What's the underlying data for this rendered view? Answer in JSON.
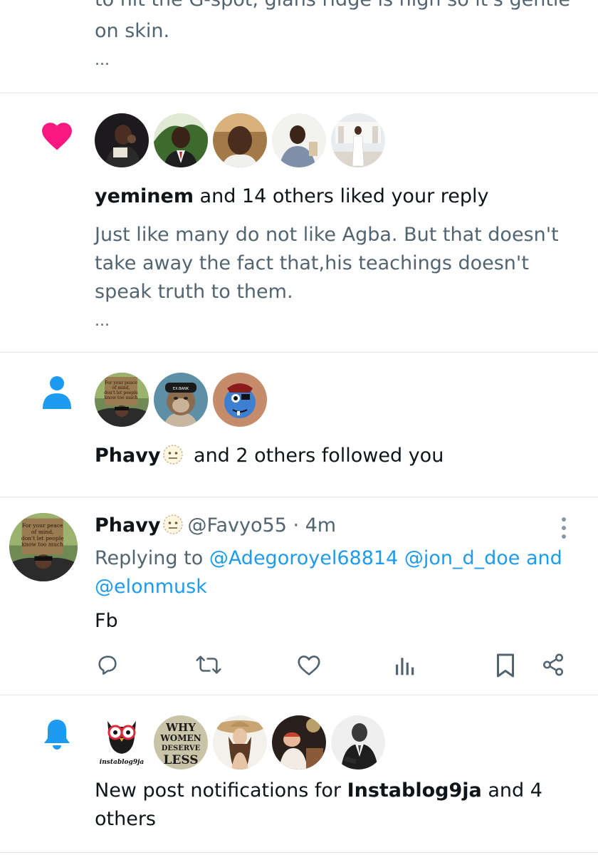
{
  "top_snippet": {
    "line1": "to hit the G-spot, glans ridge is high so it's gentle",
    "line2": "on skin.",
    "ellipsis": "..."
  },
  "like_notification": {
    "icon": "heart-icon",
    "icon_color": "#f91880",
    "user": "yeminem",
    "text_suffix": " and 14 others liked your reply",
    "reply_lines": [
      "Just like many do not like Agba. But that doesn't",
      "take away the fact that,his teachings doesn't",
      "speak truth to them."
    ],
    "ellipsis": "..."
  },
  "follow_notification": {
    "icon": "person-icon",
    "icon_color": "#1d9bf0",
    "user": "Phavy",
    "text_suffix": " and 2 others followed you"
  },
  "reply_tweet": {
    "name": "Phavy",
    "handle": "@Favyo55",
    "separator": " · ",
    "time": "4m",
    "replying_prefix": "Replying to ",
    "mentions": [
      "@Adegoroyel68814",
      "@jon_d_doe",
      "@elonmusk"
    ],
    "mention_joiner": " and",
    "body": "Fb"
  },
  "post_notification": {
    "icon": "bell-icon",
    "icon_color": "#1d9bf0",
    "prefix": "New post notifications for ",
    "account": "Instablog9ja",
    "suffix_line1": " and 4",
    "suffix_line2": "others",
    "avatar_texts": {
      "instablog": "instablog9ja",
      "book_line1": "WHY",
      "book_line2": "WOMEN",
      "book_line3": "DESERVE",
      "book_line4": "LESS"
    }
  },
  "colors": {
    "text": "#0f1419",
    "muted": "#536471",
    "link": "#1d9bf0",
    "divider": "#e4e7ea"
  }
}
